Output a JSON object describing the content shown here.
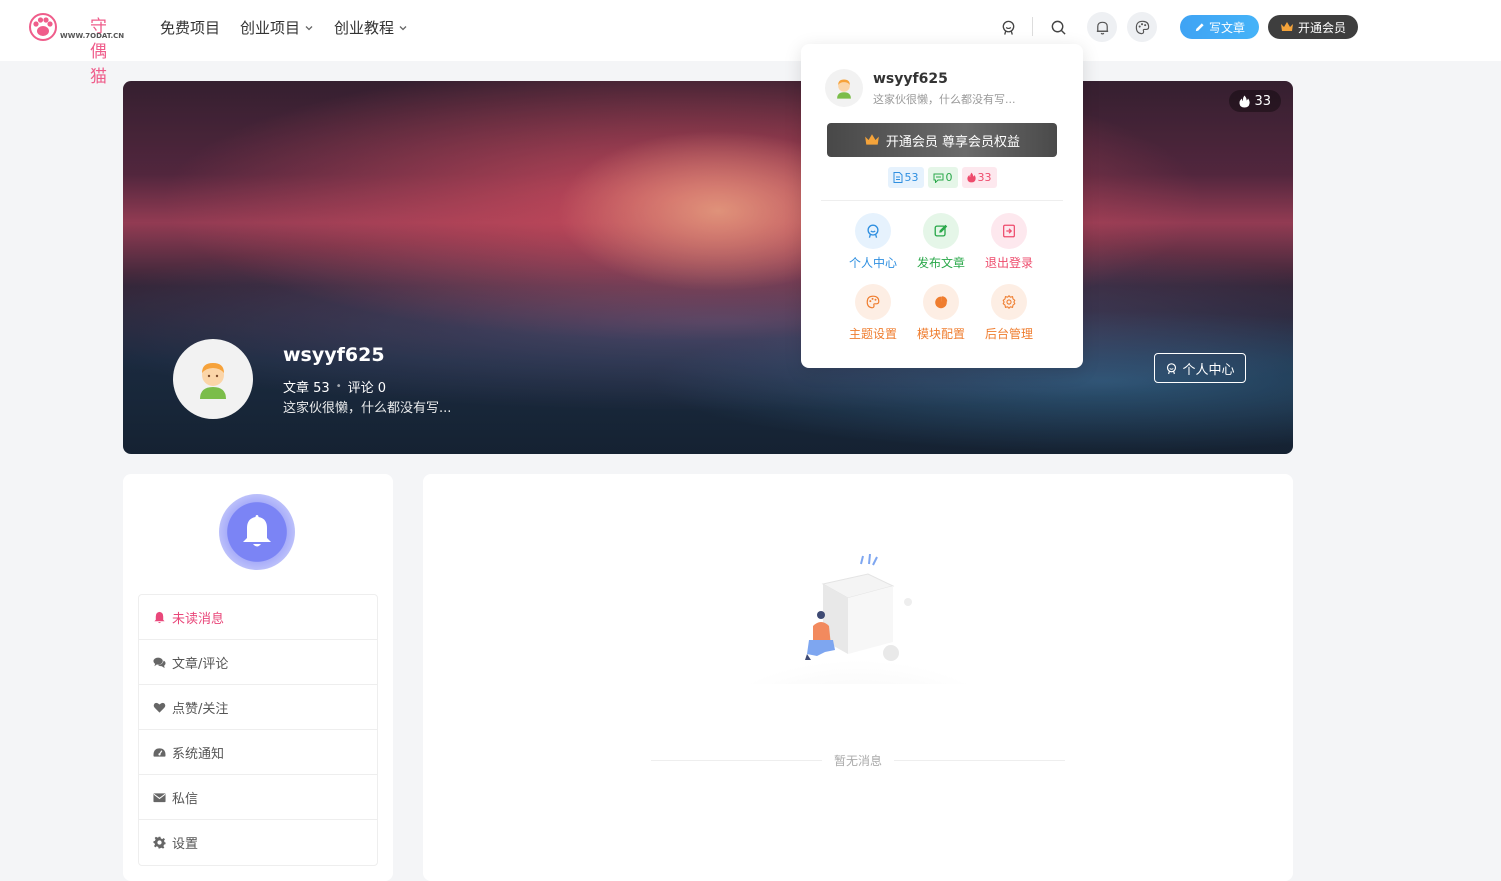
{
  "header": {
    "logo_text": "守偶猫",
    "logo_url": "WWW.7ODAT.CN",
    "nav": [
      {
        "label": "免费项目",
        "has_dropdown": false
      },
      {
        "label": "创业项目",
        "has_dropdown": true
      },
      {
        "label": "创业教程",
        "has_dropdown": true
      }
    ],
    "write_label": "写文章",
    "vip_label": "开通会员"
  },
  "banner": {
    "hot_count": "33",
    "username": "wsyyf625",
    "articles_label": "文章 53",
    "comments_label": "评论 0",
    "description": "这家伙很懒，什么都没有写...",
    "center_button": "个人中心"
  },
  "dropdown": {
    "username": "wsyyf625",
    "description": "这家伙很懒，什么都没有写...",
    "vip_banner": "开通会员 尊享会员权益",
    "badges": {
      "posts": "53",
      "comments": "0",
      "hot": "33"
    },
    "actions": [
      {
        "label": "个人中心",
        "icon": "user-badge-icon",
        "color": "#2f8fe0",
        "bg": "#e6f2fd"
      },
      {
        "label": "发布文章",
        "icon": "edit-icon",
        "color": "#2aa84a",
        "bg": "#e5f6e8"
      },
      {
        "label": "退出登录",
        "icon": "logout-icon",
        "color": "#ee4b6c",
        "bg": "#fde8ee"
      },
      {
        "label": "主题设置",
        "icon": "palette-icon",
        "color": "#ef7d2f",
        "bg": "#fdeee4"
      },
      {
        "label": "模块配置",
        "icon": "pie-chart-icon",
        "color": "#ef7d2f",
        "bg": "#fdeee4"
      },
      {
        "label": "后台管理",
        "icon": "gear-icon",
        "color": "#ef7d2f",
        "bg": "#fdeee4"
      }
    ]
  },
  "sidebar": {
    "menu": [
      {
        "label": "未读消息",
        "icon": "bell-icon",
        "active": true
      },
      {
        "label": "文章/评论",
        "icon": "comments-icon",
        "active": false
      },
      {
        "label": "点赞/关注",
        "icon": "heart-icon",
        "active": false
      },
      {
        "label": "系统通知",
        "icon": "dashboard-icon",
        "active": false
      },
      {
        "label": "私信",
        "icon": "envelope-icon",
        "active": false
      },
      {
        "label": "设置",
        "icon": "gear-icon",
        "active": false
      }
    ]
  },
  "main": {
    "empty_text": "暂无消息"
  },
  "colors": {
    "accent_pink": "#e9477a",
    "write_blue": "#3fa3f4",
    "vip_dark": "#3e3e3e"
  }
}
